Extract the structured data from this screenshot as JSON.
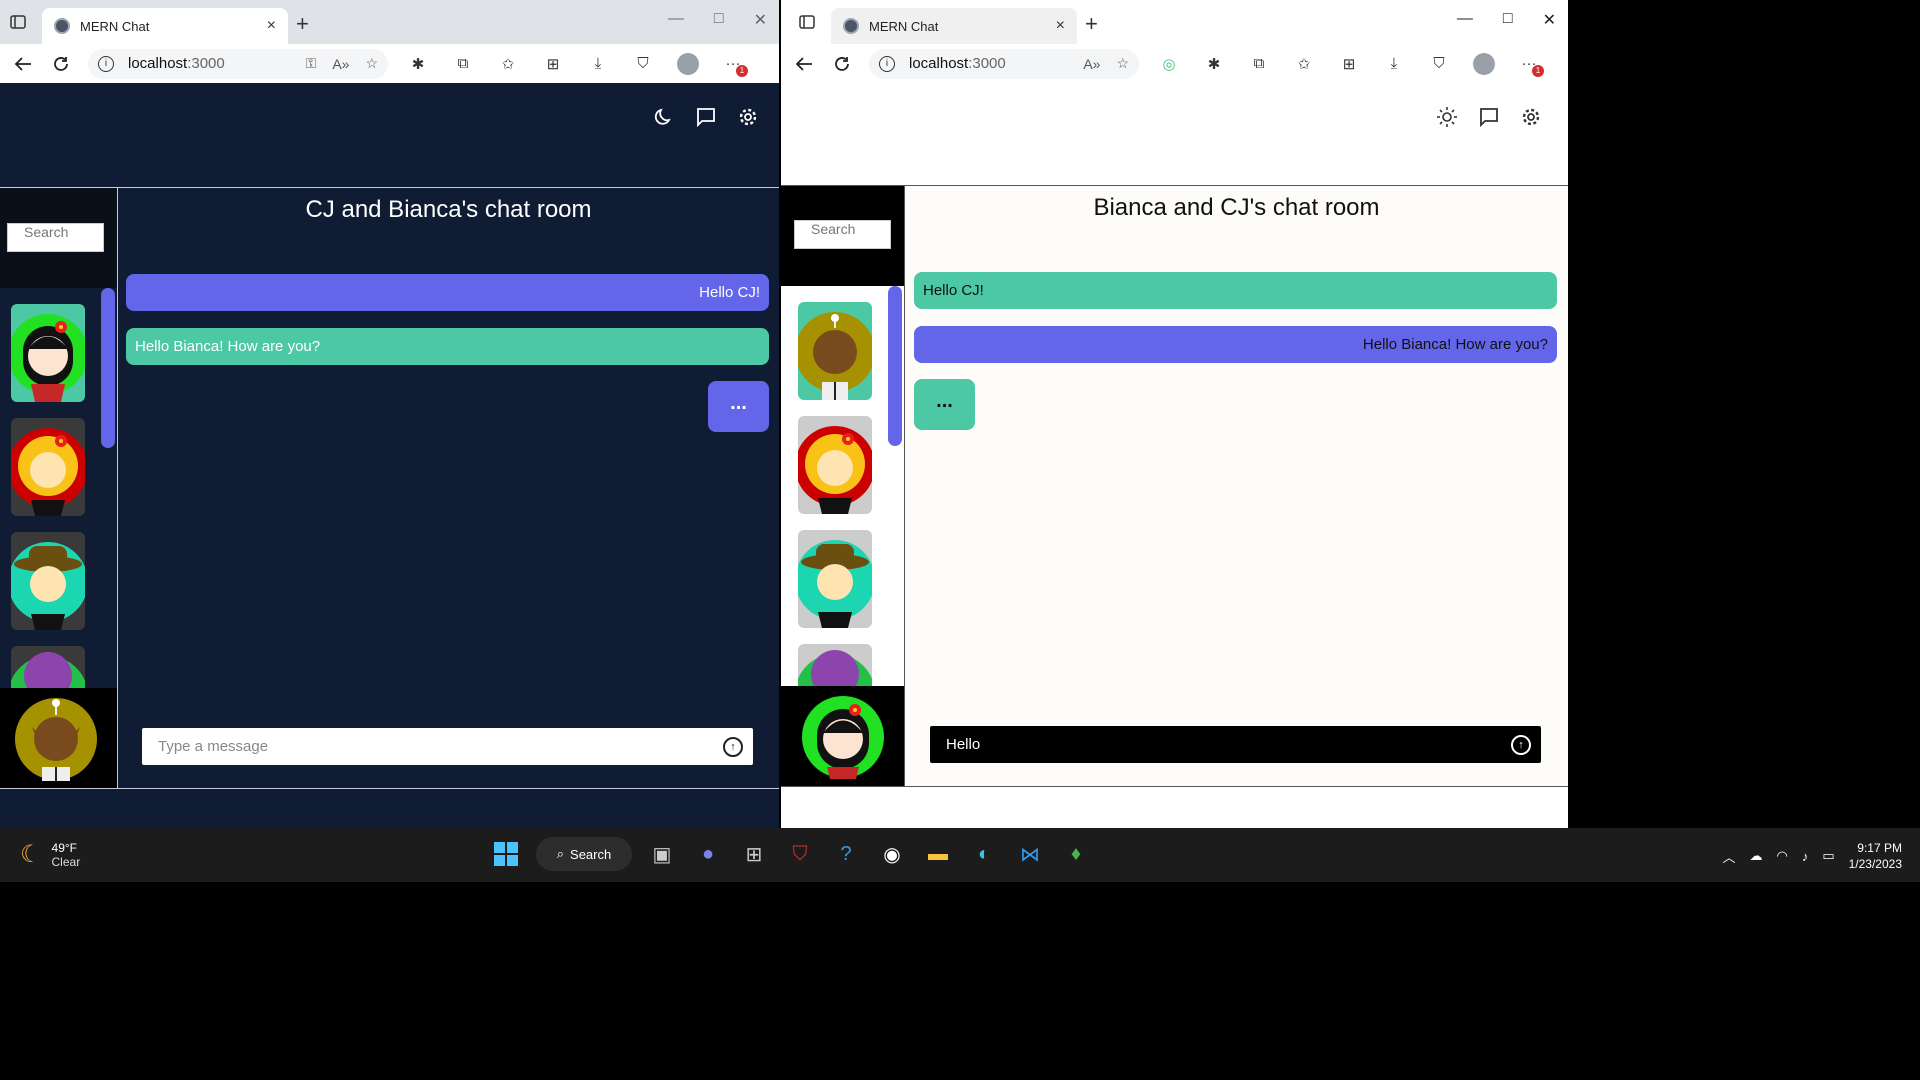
{
  "browser": {
    "tab_title": "MERN Chat",
    "tab_close": "×",
    "new_tab": "+",
    "url_host": "localhost",
    "url_port": ":3000",
    "win_min": "—",
    "win_max": "□",
    "win_close": "✕",
    "more": "···",
    "more_badge": "1"
  },
  "left_window": {
    "theme": "dark",
    "search_placeholder": "Search",
    "room_title": "CJ and Bianca's chat room",
    "messages": [
      {
        "text": "Hello CJ!",
        "side": "right",
        "color": "#6366e8"
      },
      {
        "text": "Hello Bianca! How are you?",
        "side": "left",
        "color": "#4cc9a4"
      }
    ],
    "typing_indicator": "...",
    "composer_placeholder": "Type a message",
    "composer_value": ""
  },
  "right_window": {
    "theme": "light",
    "search_placeholder": "Search",
    "room_title": "Bianca and CJ's chat room",
    "messages": [
      {
        "text": "Hello CJ!",
        "side": "left",
        "color": "#4cc9a4"
      },
      {
        "text": "Hello Bianca! How are you?",
        "side": "right",
        "color": "#6366e8"
      }
    ],
    "typing_indicator": "...",
    "composer_placeholder": "",
    "composer_value": "Hello"
  },
  "taskbar": {
    "weather_temp": "49°F",
    "weather_desc": "Clear",
    "search_label": "Search",
    "time": "9:17 PM",
    "date": "1/23/2023"
  },
  "colors": {
    "dark_bg": "#101c33",
    "accent_blue": "#6366e8",
    "accent_green": "#4cc9a4"
  }
}
